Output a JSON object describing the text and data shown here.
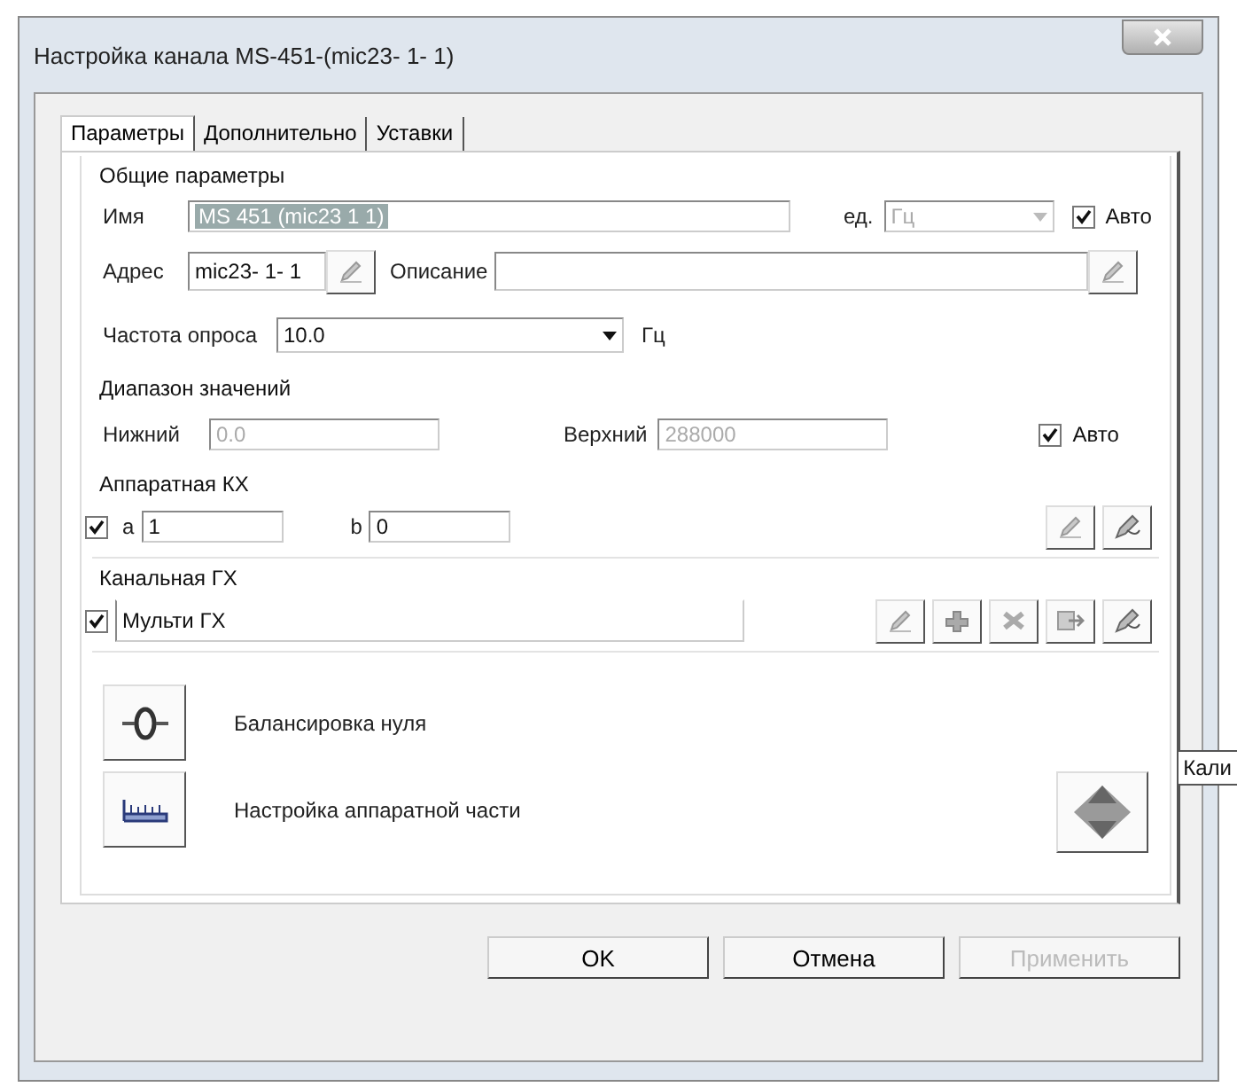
{
  "window": {
    "title": "Настройка канала MS-451-(mic23- 1- 1)"
  },
  "tabs": [
    {
      "label": "Параметры",
      "selected": true
    },
    {
      "label": "Дополнительно",
      "selected": false
    },
    {
      "label": "Уставки",
      "selected": false
    }
  ],
  "general": {
    "legend": "Общие параметры",
    "name_label": "Имя",
    "name_value": "MS 451 (mic23 1 1)",
    "name_disabled": true,
    "unit_label": "ед.",
    "unit_value": "Гц",
    "unit_disabled": true,
    "auto": {
      "label": "Авто",
      "checked": true
    },
    "address_label": "Адрес",
    "address_value": "mic23- 1- 1",
    "description_label": "Описание",
    "rate_label": "Частота опроса",
    "rate_value": "10.0",
    "rate_unit": "Гц"
  },
  "range": {
    "legend": "Диапазон значений",
    "lower_label": "Нижний",
    "lower_value": "0.0",
    "upper_label": "Верхний",
    "upper_value": "288000",
    "disabled": true,
    "auto": {
      "label": "Авто",
      "checked": true
    }
  },
  "hardware": {
    "legend": "Аппаратная КХ",
    "checked": true,
    "a_label": "a",
    "a_value": "1",
    "b_label": "b",
    "b_value": "0"
  },
  "channel": {
    "legend": "Канальная ГХ",
    "checked": true,
    "value": "Мульти ГХ"
  },
  "actions": [
    {
      "kind": "balance",
      "label": "Балансировка нуля"
    },
    {
      "kind": "hardware",
      "label": "Настройка аппаратной части"
    }
  ],
  "tooltip": "Кали",
  "buttons": [
    {
      "label": "OK",
      "disabled": false
    },
    {
      "label": "Отмена",
      "disabled": false
    },
    {
      "label": "Применить",
      "disabled": true
    }
  ]
}
